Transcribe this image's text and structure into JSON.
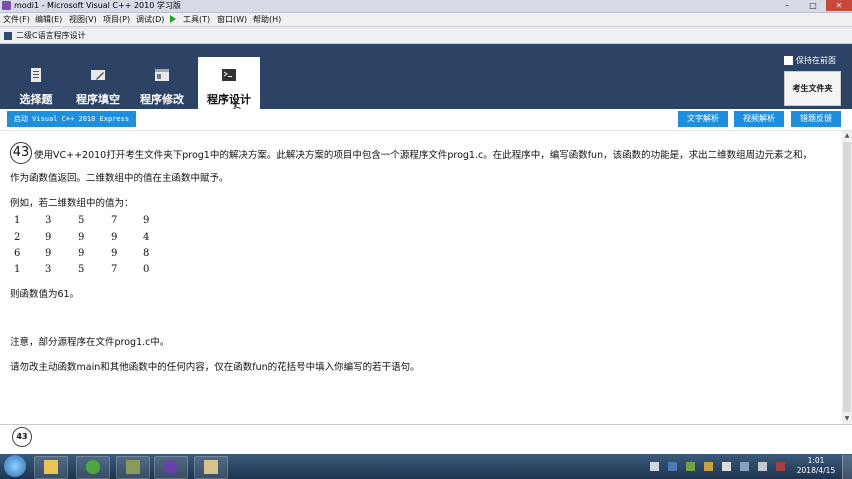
{
  "window": {
    "title": "modi1 - Microsoft Visual C++ 2010 学习版",
    "controls": [
      "–",
      "□",
      "✕"
    ]
  },
  "menu": [
    "文件(F)",
    "编辑(E)",
    "视图(V)",
    "项目(P)",
    "调试(D)",
    "工具(T)",
    "窗口(W)",
    "帮助(H)"
  ],
  "inner_title": "二级C语言程序设计",
  "nav": {
    "tabs": [
      {
        "label": "选择题",
        "icon": "document-icon"
      },
      {
        "label": "程序填空",
        "icon": "edit-icon"
      },
      {
        "label": "程序修改",
        "icon": "window-icon"
      },
      {
        "label": "程序设计",
        "icon": "terminal-icon"
      }
    ],
    "active_index": 3,
    "keep_front": "保持在前面",
    "exam_folder": "考生文件夹"
  },
  "toolbar": {
    "launch": "启动 Visual C++ 2010 Express",
    "text_analysis": "文字解析",
    "video_analysis": "视频解析",
    "feedback": "错题反馈"
  },
  "question": {
    "number": "43",
    "line1": "使用VC++2010打开考生文件夹下prog1中的解决方案。此解决方案的项目中包含一个源程序文件prog1.c。在此程序中，编写函数fun，该函数的功能是，求出二维数组周边元素之和，",
    "line2": "作为函数值返回。二维数组中的值在主函数中赋予。",
    "example_intro": "例如，若二维数组中的值为：",
    "matrix": [
      [
        "1",
        "3",
        "5",
        "7",
        "9"
      ],
      [
        "2",
        "9",
        "9",
        "9",
        "4"
      ],
      [
        "6",
        "9",
        "9",
        "9",
        "8"
      ],
      [
        "1",
        "3",
        "5",
        "7",
        "0"
      ]
    ],
    "result": "则函数值为61。",
    "note": "注意，部分源程序在文件prog1.c中。",
    "instruction": "请勿改主动函数main和其他函数中的任何内容，仅在函数fun的花括号中填入你编写的若干语句。"
  },
  "footer": {
    "number": "43"
  },
  "taskbar": {
    "time": "1:01",
    "date": "2018/4/15"
  },
  "colors": {
    "nav_bg": "#2c4366",
    "accent": "#1f8fdc",
    "taskbar": "#1e3550"
  }
}
